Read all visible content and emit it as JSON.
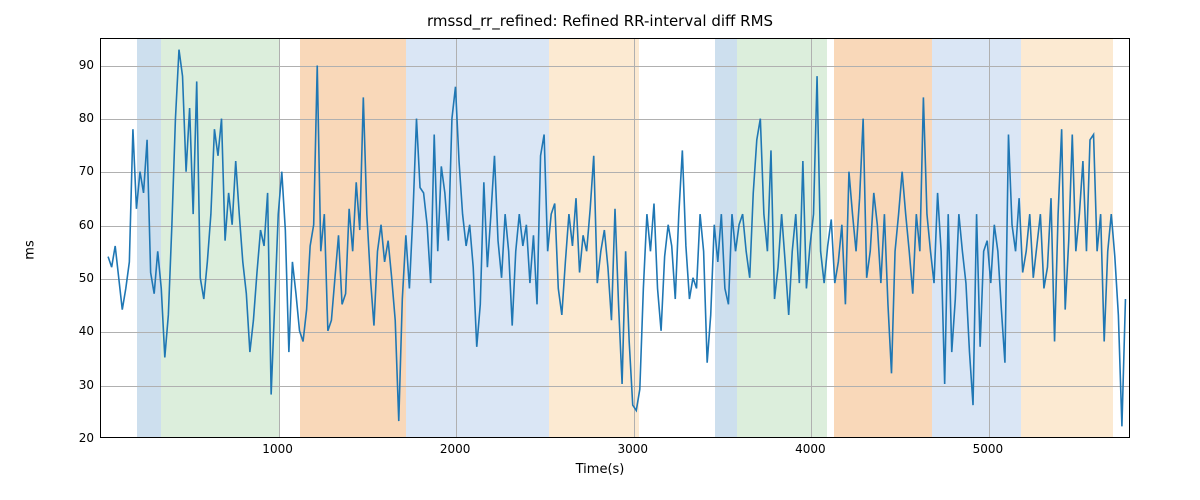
{
  "chart_data": {
    "type": "line",
    "title": "rmssd_rr_refined: Refined RR-interval diff RMS",
    "xlabel": "Time(s)",
    "ylabel": "ms",
    "xlim": [
      0,
      5800
    ],
    "ylim": [
      20,
      95
    ],
    "xticks": [
      1000,
      2000,
      3000,
      4000,
      5000
    ],
    "yticks": [
      20,
      30,
      40,
      50,
      60,
      70,
      80,
      90
    ],
    "series": [
      {
        "name": "rmssd_rr_refined",
        "color": "#1f77b4",
        "x": [
          40,
          60,
          80,
          100,
          120,
          140,
          160,
          180,
          200,
          220,
          240,
          260,
          280,
          300,
          320,
          340,
          360,
          380,
          400,
          420,
          440,
          460,
          480,
          500,
          520,
          540,
          560,
          580,
          600,
          620,
          640,
          660,
          680,
          700,
          720,
          740,
          760,
          780,
          800,
          820,
          840,
          860,
          880,
          900,
          920,
          940,
          960,
          980,
          1000,
          1020,
          1040,
          1060,
          1080,
          1100,
          1120,
          1140,
          1160,
          1180,
          1200,
          1220,
          1240,
          1260,
          1280,
          1300,
          1320,
          1340,
          1360,
          1380,
          1400,
          1420,
          1440,
          1460,
          1480,
          1500,
          1520,
          1540,
          1560,
          1580,
          1600,
          1620,
          1640,
          1660,
          1680,
          1700,
          1720,
          1740,
          1760,
          1780,
          1800,
          1820,
          1840,
          1860,
          1880,
          1900,
          1920,
          1940,
          1960,
          1980,
          2000,
          2020,
          2040,
          2060,
          2080,
          2100,
          2120,
          2140,
          2160,
          2180,
          2200,
          2220,
          2240,
          2260,
          2280,
          2300,
          2320,
          2340,
          2360,
          2380,
          2400,
          2420,
          2440,
          2460,
          2480,
          2500,
          2520,
          2540,
          2560,
          2580,
          2600,
          2620,
          2640,
          2660,
          2680,
          2700,
          2720,
          2740,
          2760,
          2780,
          2800,
          2820,
          2840,
          2860,
          2880,
          2900,
          2920,
          2940,
          2960,
          2980,
          3000,
          3020,
          3040,
          3060,
          3080,
          3100,
          3120,
          3140,
          3160,
          3180,
          3200,
          3220,
          3240,
          3260,
          3280,
          3300,
          3320,
          3340,
          3360,
          3380,
          3400,
          3420,
          3440,
          3460,
          3480,
          3500,
          3520,
          3540,
          3560,
          3580,
          3600,
          3620,
          3640,
          3660,
          3680,
          3700,
          3720,
          3740,
          3760,
          3780,
          3800,
          3820,
          3840,
          3860,
          3880,
          3900,
          3920,
          3940,
          3960,
          3980,
          4000,
          4020,
          4040,
          4060,
          4080,
          4100,
          4120,
          4140,
          4160,
          4180,
          4200,
          4220,
          4240,
          4260,
          4280,
          4300,
          4320,
          4340,
          4360,
          4380,
          4400,
          4420,
          4440,
          4460,
          4480,
          4500,
          4520,
          4540,
          4560,
          4580,
          4600,
          4620,
          4640,
          4660,
          4680,
          4700,
          4720,
          4740,
          4760,
          4780,
          4800,
          4820,
          4840,
          4860,
          4880,
          4900,
          4920,
          4940,
          4960,
          4980,
          5000,
          5020,
          5040,
          5060,
          5080,
          5100,
          5120,
          5140,
          5160,
          5180,
          5200,
          5220,
          5240,
          5260,
          5280,
          5300,
          5320,
          5340,
          5360,
          5380,
          5400,
          5420,
          5440,
          5460,
          5480,
          5500,
          5520,
          5540,
          5560,
          5580,
          5600,
          5620,
          5640,
          5660,
          5680,
          5700,
          5720,
          5740,
          5760,
          5780
        ],
        "y": [
          54,
          52,
          56,
          50,
          44,
          48,
          53,
          78,
          63,
          70,
          66,
          76,
          51,
          47,
          55,
          48,
          35,
          43,
          60,
          80,
          93,
          88,
          70,
          82,
          62,
          87,
          50,
          46,
          53,
          62,
          78,
          73,
          80,
          57,
          66,
          60,
          72,
          62,
          53,
          47,
          36,
          42,
          51,
          59,
          56,
          66,
          28,
          45,
          62,
          70,
          59,
          36,
          53,
          47,
          40,
          38,
          44,
          56,
          60,
          90,
          55,
          62,
          40,
          42,
          50,
          58,
          45,
          47,
          63,
          55,
          68,
          59,
          84,
          62,
          50,
          41,
          55,
          60,
          53,
          57,
          50,
          42,
          23,
          46,
          58,
          48,
          62,
          80,
          67,
          66,
          60,
          49,
          77,
          55,
          71,
          66,
          57,
          80,
          86,
          72,
          62,
          56,
          60,
          52,
          37,
          45,
          68,
          52,
          62,
          73,
          57,
          50,
          62,
          55,
          41,
          55,
          62,
          56,
          60,
          49,
          58,
          45,
          73,
          77,
          55,
          62,
          64,
          48,
          43,
          53,
          62,
          56,
          65,
          51,
          58,
          55,
          63,
          73,
          49,
          55,
          59,
          52,
          42,
          63,
          45,
          30,
          55,
          38,
          26,
          25,
          29,
          48,
          62,
          55,
          64,
          48,
          40,
          54,
          60,
          56,
          46,
          62,
          74,
          56,
          46,
          50,
          48,
          62,
          55,
          34,
          43,
          60,
          53,
          62,
          48,
          45,
          62,
          55,
          60,
          62,
          55,
          50,
          66,
          76,
          80,
          62,
          55,
          74,
          46,
          52,
          62,
          53,
          43,
          55,
          62,
          49,
          72,
          48,
          56,
          62,
          88,
          55,
          49,
          56,
          61,
          49,
          53,
          60,
          45,
          70,
          62,
          55,
          65,
          80,
          50,
          55,
          66,
          60,
          49,
          62,
          45,
          32,
          55,
          62,
          70,
          62,
          55,
          47,
          62,
          55,
          84,
          62,
          55,
          49,
          66,
          55,
          30,
          62,
          36,
          46,
          62,
          55,
          49,
          36,
          26,
          62,
          37,
          55,
          57,
          49,
          60,
          55,
          44,
          34,
          77,
          60,
          55,
          65,
          51,
          55,
          62,
          50,
          56,
          62,
          48,
          52,
          65,
          38,
          62,
          78,
          44,
          57,
          77,
          55,
          62,
          72,
          55,
          76,
          77,
          55,
          62,
          38,
          55,
          62,
          54,
          43,
          22,
          46
        ]
      }
    ],
    "bands": [
      {
        "x0": 200,
        "x1": 340,
        "color": "rgba(112,164,207,0.35)"
      },
      {
        "x0": 340,
        "x1": 1010,
        "color": "rgba(154,205,154,0.35)"
      },
      {
        "x0": 1120,
        "x1": 1720,
        "color": "rgba(243,178,116,0.5)"
      },
      {
        "x0": 1720,
        "x1": 2520,
        "color": "rgba(174,199,232,0.45)"
      },
      {
        "x0": 2520,
        "x1": 3030,
        "color": "rgba(250,213,165,0.5)"
      },
      {
        "x0": 3460,
        "x1": 3580,
        "color": "rgba(112,164,207,0.35)"
      },
      {
        "x0": 3580,
        "x1": 4090,
        "color": "rgba(154,205,154,0.35)"
      },
      {
        "x0": 4130,
        "x1": 4680,
        "color": "rgba(243,178,116,0.5)"
      },
      {
        "x0": 4680,
        "x1": 5180,
        "color": "rgba(174,199,232,0.45)"
      },
      {
        "x0": 5180,
        "x1": 5700,
        "color": "rgba(250,213,165,0.5)"
      }
    ]
  }
}
